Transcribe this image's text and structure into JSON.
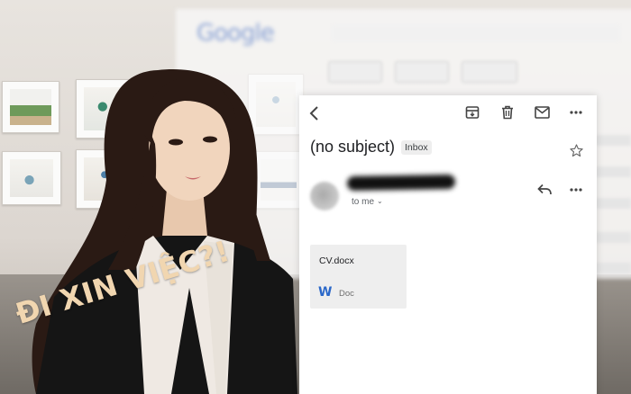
{
  "background": {
    "logo_text": "Google"
  },
  "email": {
    "subject": "(no subject)",
    "label_badge": "Inbox",
    "recipient_text": "to me",
    "attachment": {
      "file_name": "CV.docx",
      "file_type": "Doc",
      "type_icon_letter": "W"
    }
  },
  "toolbar": {
    "icons": [
      "back-arrow-icon",
      "archive-icon",
      "trash-icon",
      "mail-icon",
      "more-icon"
    ]
  },
  "header_icons": [
    "star-icon",
    "reply-icon",
    "more-icon"
  ],
  "overlay": {
    "headline": "ĐI XIN VIỆC?!"
  },
  "colors": {
    "headline": "#f1d6b0",
    "card_bg": "#ffffff",
    "attachment_bg": "#eeeeee",
    "doc_icon": "#2b68c9"
  }
}
